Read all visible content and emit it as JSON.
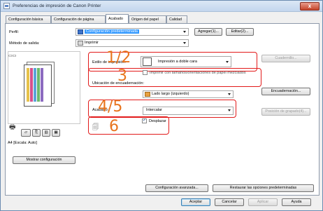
{
  "window": {
    "title": "Preferencias de impresión de Canon Printer",
    "close_glyph": "x"
  },
  "tabs": [
    {
      "label": "Configuración básica"
    },
    {
      "label": "Configuración de página"
    },
    {
      "label": "Acabado"
    },
    {
      "label": "Origen del papel"
    },
    {
      "label": "Calidad"
    }
  ],
  "profile": {
    "label": "Perfil:",
    "value": "Configuración predeterminada",
    "add_label": "Agregar(1)...",
    "edit_label": "Editar(2)..."
  },
  "output": {
    "label": "Método de salida:",
    "value": "Imprimir"
  },
  "printing_style": {
    "label": "Estilo de impresión:",
    "value": "Impresión a doble cara",
    "booklet_label": "Cuadernillo..."
  },
  "mixed_sizes": {
    "label": "Imprimir con tamaños/orientaciones de papel mezclados",
    "checked": false
  },
  "binding": {
    "label": "Ubicación de encuadernación:",
    "value": "Lado largo (izquierdo)",
    "button_label": "Encuadernación..."
  },
  "finishing": {
    "label": "Acabado:",
    "value": "Intercalar",
    "stapling_label": "Posición de grapado(4)..."
  },
  "offset": {
    "label": "Desplazar",
    "checked": true
  },
  "annotations": {
    "n1": "1/2",
    "n2": "3",
    "n3": "4/5",
    "n4": "6"
  },
  "preview": {
    "caption": "A4 [Escala: Auto]",
    "view_settings_label": "Mostrar configuración"
  },
  "footer": {
    "advanced_label": "Configuración avanzada...",
    "restore_label": "Restaurar las opciones predeterminadas",
    "ok_label": "Aceptar",
    "cancel_label": "Cancelar",
    "apply_label": "Aplicar",
    "help_label": "Ayuda"
  },
  "colors": {
    "accent": "#3399ff",
    "annotation_box": "#e21a1a",
    "annotation_number": "#e8741d"
  }
}
